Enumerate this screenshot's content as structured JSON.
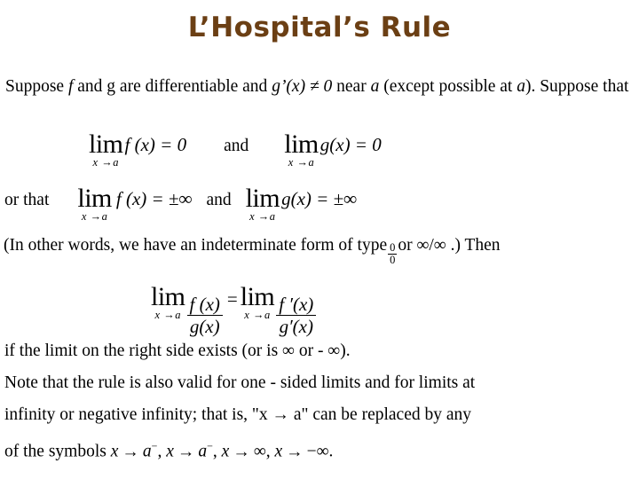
{
  "slide": {
    "title": "L’Hospital’s Rule",
    "title_color": "#6b3f14",
    "background_color": "#ffffff"
  },
  "intro": {
    "part1": "Suppose ",
    "var_f": "f",
    "part2": " and ",
    "var_g": "g",
    "part3": " are differentiable and ",
    "cond": "g’(x) ≠ 0",
    "part4": " near ",
    "var_a": "a",
    "part5": " (except possible at ",
    "var_a2": "a",
    "part6": "). Suppose that"
  },
  "line1": {
    "lim_label": "lim",
    "lim_sub": "x →a",
    "left_expr": "f (x) = 0",
    "conjunction": "and",
    "right_lim_label": "lim",
    "right_lim_sub": "x →a",
    "right_expr": "g(x) = 0"
  },
  "line2": {
    "prefix": "or that",
    "lim_label": "lim",
    "lim_sub": "x →a",
    "left_expr": "f (x) = ±∞",
    "conjunction": "and",
    "right_lim_label": "lim",
    "right_lim_sub": "x →a",
    "right_expr": "g(x) = ±∞"
  },
  "indeterminate": {
    "before_frac": "(In other words, we have an indeterminate form of type ",
    "frac_num": "0",
    "frac_den": "0",
    "after_frac": " or ∞/∞ .) Then"
  },
  "main_equation": {
    "lhs_lim_label": "lim",
    "lhs_lim_sub": "x →a",
    "lhs_num": "f (x)",
    "lhs_den": "g(x)",
    "equals": "=",
    "rhs_lim_label": "lim",
    "rhs_lim_sub": "x →a",
    "rhs_num": "f ′(x)",
    "rhs_den": "g′(x)"
  },
  "notes": {
    "line_a": "if the limit on the right side exists (or is ∞ or - ∞).",
    "line_b": "Note that the rule is also valid for one - sided limits and for limits at",
    "line_c_part1": "infinity or negative infinity; that is, \"x ",
    "line_c_arrow": "→",
    "line_c_part2": " a\" can be replaced by any",
    "line_d_prefix": "of the symbols ",
    "sym1_var": "x",
    "sym1_arrow": "→",
    "sym1_target": "a",
    "sym1_sign": "−",
    "sym2_var": "x",
    "sym2_arrow": "→",
    "sym2_target": "a",
    "sym2_sign": "−",
    "sym3_var": "x",
    "sym3_arrow": "→",
    "sym3_target": "∞",
    "sym4_var": "x",
    "sym4_arrow": "→",
    "sym4_target": "−∞",
    "line_d_end": "."
  }
}
